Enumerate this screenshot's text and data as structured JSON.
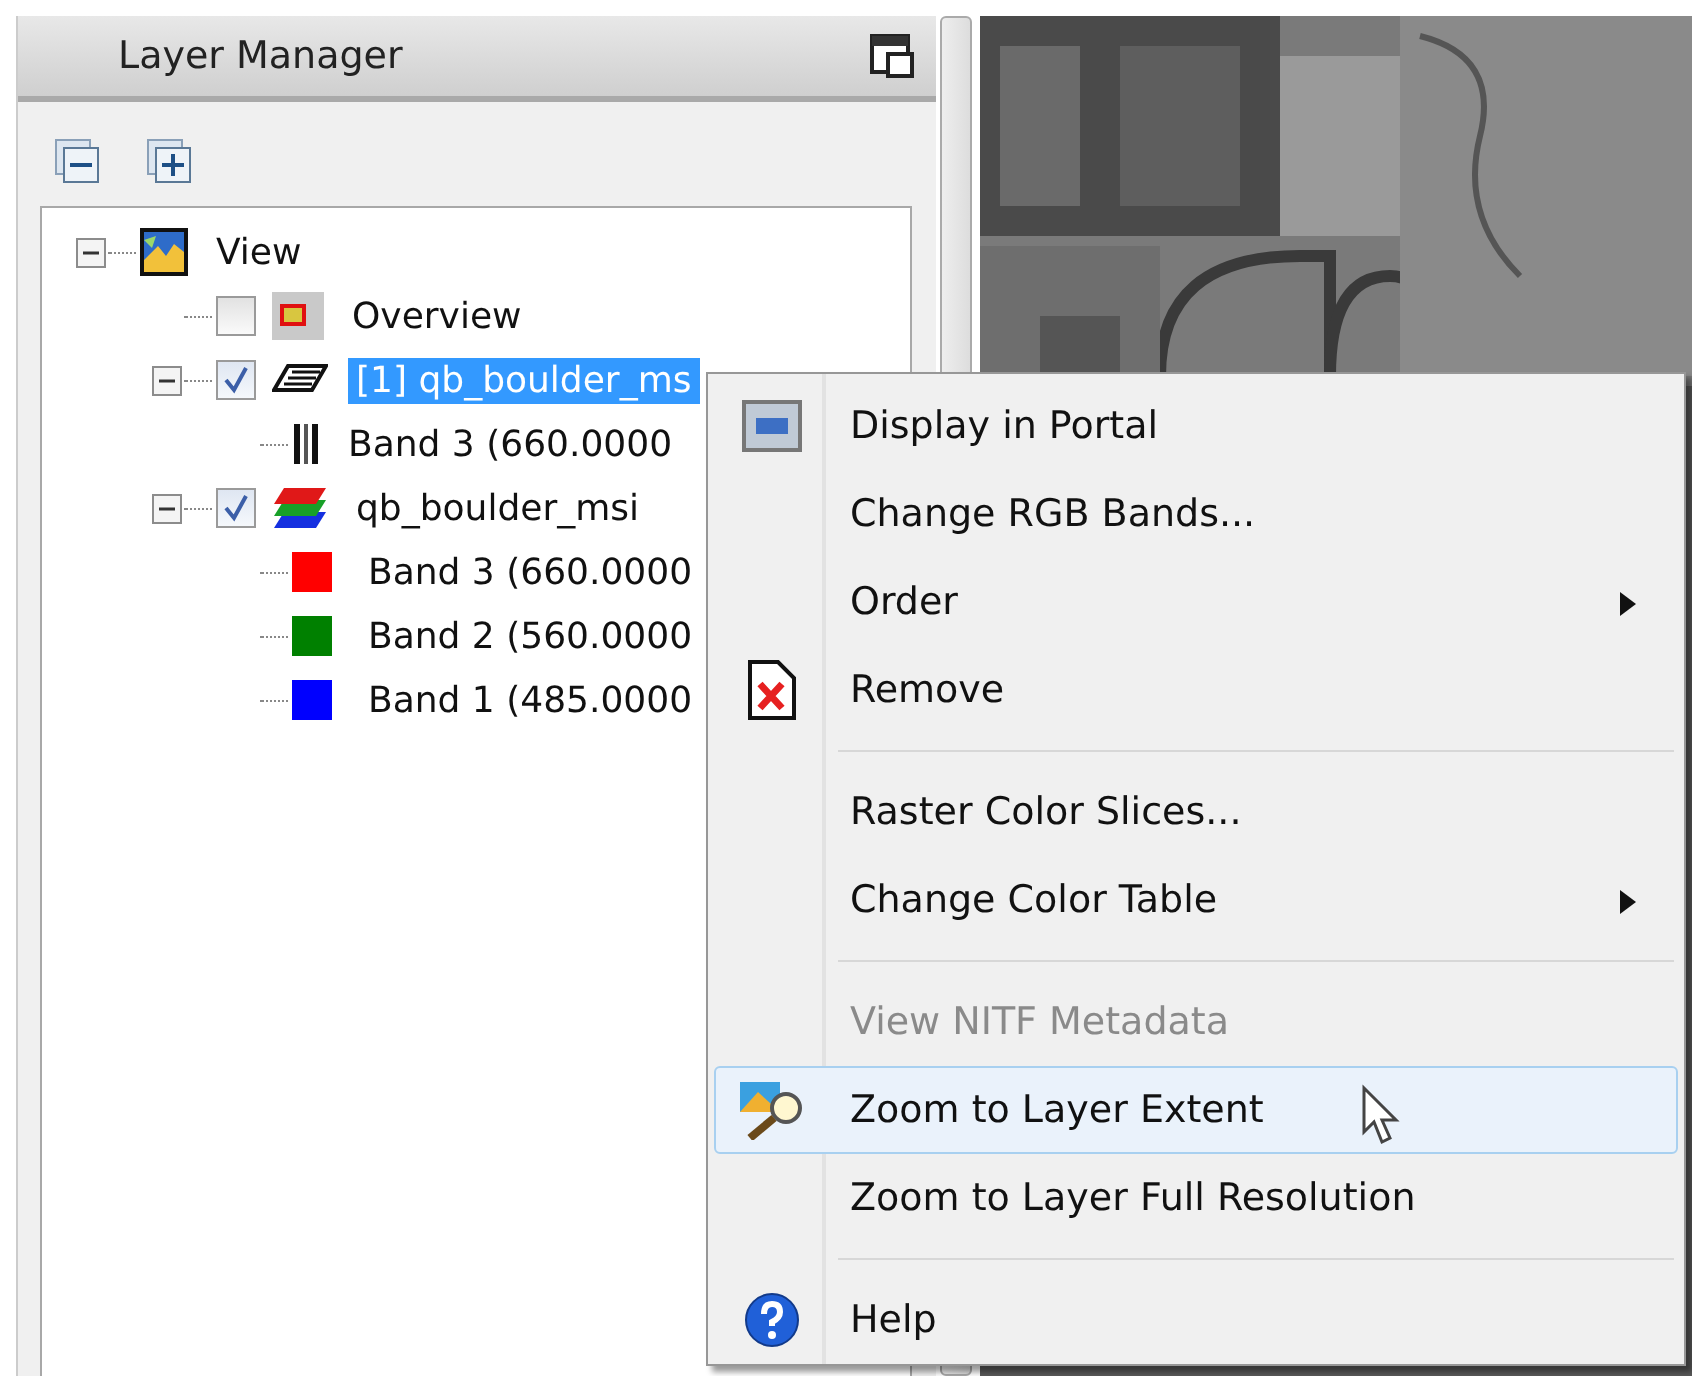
{
  "panel": {
    "title": "Layer Manager"
  },
  "tree": [
    {
      "label": "View",
      "kind": "view",
      "expanded": true,
      "selected": false,
      "children": [
        {
          "label": "Overview",
          "kind": "overview",
          "checked": false,
          "selected": false
        },
        {
          "label": "[1] qb_boulder_ms",
          "kind": "grid",
          "checked": true,
          "expanded": true,
          "selected": true,
          "children": [
            {
              "label": "Band 3 (660.0000",
              "kind": "bars",
              "selected": false
            }
          ]
        },
        {
          "label": "qb_boulder_msi",
          "kind": "rgb",
          "checked": true,
          "expanded": true,
          "selected": false,
          "children": [
            {
              "label": "Band 3 (660.0000",
              "kind": "swatch",
              "color": "#ff0000",
              "selected": false
            },
            {
              "label": "Band 2 (560.0000",
              "kind": "swatch",
              "color": "#008000",
              "selected": false
            },
            {
              "label": "Band 1 (485.0000",
              "kind": "swatch",
              "color": "#0000ff",
              "selected": false
            }
          ]
        }
      ]
    }
  ],
  "context_menu": [
    {
      "kind": "portal",
      "label": "Display in Portal",
      "submenu": false,
      "disabled": false,
      "selected": false
    },
    {
      "kind": "item",
      "label": "Change RGB Bands...",
      "submenu": false,
      "disabled": false,
      "selected": false
    },
    {
      "kind": "item",
      "label": "Order",
      "submenu": true,
      "disabled": false,
      "selected": false
    },
    {
      "kind": "remove",
      "label": "Remove",
      "submenu": false,
      "disabled": false,
      "selected": false
    },
    {
      "kind": "separator"
    },
    {
      "kind": "item",
      "label": "Raster Color Slices...",
      "submenu": false,
      "disabled": false,
      "selected": false
    },
    {
      "kind": "item",
      "label": "Change Color Table",
      "submenu": true,
      "disabled": false,
      "selected": false
    },
    {
      "kind": "separator"
    },
    {
      "kind": "item",
      "label": "View NITF Metadata",
      "submenu": false,
      "disabled": true,
      "selected": false
    },
    {
      "kind": "zoom",
      "label": "Zoom to Layer Extent",
      "submenu": false,
      "disabled": false,
      "selected": true
    },
    {
      "kind": "item",
      "label": "Zoom to Layer Full Resolution",
      "submenu": false,
      "disabled": false,
      "selected": false
    },
    {
      "kind": "separator"
    },
    {
      "kind": "help",
      "label": "Help",
      "submenu": false,
      "disabled": false,
      "selected": false
    }
  ]
}
